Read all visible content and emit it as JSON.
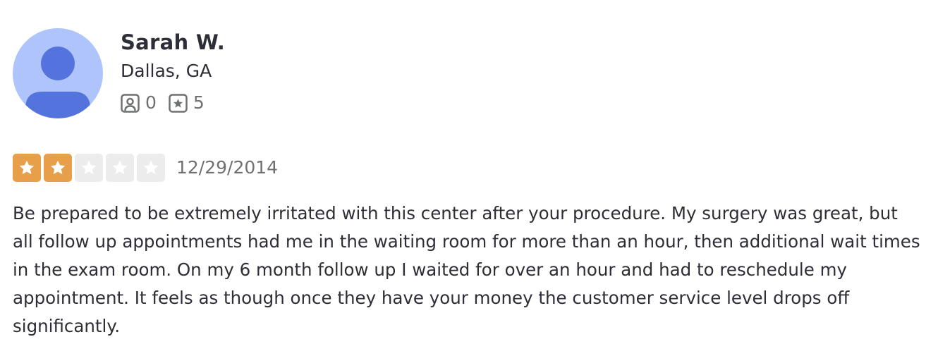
{
  "reviewer": {
    "name": "Sarah W.",
    "location": "Dallas, GA",
    "avatar_icon": "user-silhouette-icon",
    "avatar_bg": "#aec4fa",
    "avatar_fg": "#5573dd",
    "friends_count": "0",
    "reviews_count": "5"
  },
  "review": {
    "rating": 2,
    "rating_max": 5,
    "star_color": "#e89f4a",
    "empty_star_color": "#ececec",
    "date": "12/29/2014",
    "text": "Be prepared to be extremely irritated with this center after your procedure. My surgery was great, but all follow up appointments had me in the waiting room for more than an hour, then additional wait times in the exam room. On my 6 month follow up I waited for over an hour and had to reschedule my appointment. It feels as though once they have your money the customer service level drops off significantly."
  }
}
